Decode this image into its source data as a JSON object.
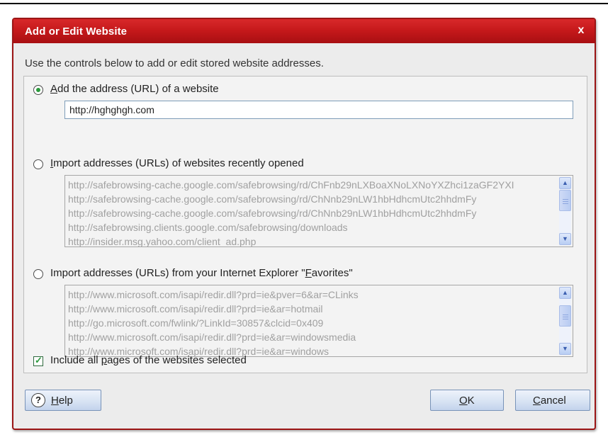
{
  "dialog": {
    "title": "Add or Edit Website",
    "close_label": "x",
    "intro": "Use the controls below to add or edit stored website addresses."
  },
  "option_add": {
    "selected": true,
    "label_prefix": "",
    "label_accel": "A",
    "label_rest": "dd the address (URL) of a website",
    "url_value": "http://hghghgh.com"
  },
  "option_recent": {
    "selected": false,
    "label_prefix": "",
    "label_accel": "I",
    "label_rest": "mport addresses (URLs) of websites recently opened",
    "items": [
      "http://safebrowsing-cache.google.com/safebrowsing/rd/ChFnb29nLXBoaXNoLXNoYXZhci1zaGF2YXI",
      "http://safebrowsing-cache.google.com/safebrowsing/rd/ChNnb29nLW1hbHdhcmUtc2hhdmFy",
      "http://safebrowsing-cache.google.com/safebrowsing/rd/ChNnb29nLW1hbHdhcmUtc2hhdmFy",
      "http://safebrowsing.clients.google.com/safebrowsing/downloads",
      "http://insider.msg.yahoo.com/client_ad.php"
    ]
  },
  "option_favorites": {
    "selected": false,
    "label_prefix": "Import addresses (URLs) from your Internet Explorer \"",
    "label_accel": "F",
    "label_rest": "avorites\"",
    "items": [
      "http://www.microsoft.com/isapi/redir.dll?prd=ie&pver=6&ar=CLinks",
      "http://www.microsoft.com/isapi/redir.dll?prd=ie&ar=hotmail",
      "http://go.microsoft.com/fwlink/?LinkId=30857&clcid=0x409",
      "http://www.microsoft.com/isapi/redir.dll?prd=ie&ar=windowsmedia",
      "http://www.microsoft.com/isapi/redir.dll?prd=ie&ar=windows"
    ]
  },
  "include_pages": {
    "checked": true,
    "label_prefix": "Include all ",
    "label_accel": "p",
    "label_rest": "ages of the websites selected"
  },
  "buttons": {
    "help_icon": "?",
    "help_accel": "H",
    "help_rest": "elp",
    "ok_accel": "O",
    "ok_rest": "K",
    "cancel_accel": "C",
    "cancel_rest": "ancel"
  },
  "colors": {
    "title_bar": "#c4181a",
    "radio_selected": "#2a9a3c",
    "button_face": "#d8e3f3"
  }
}
